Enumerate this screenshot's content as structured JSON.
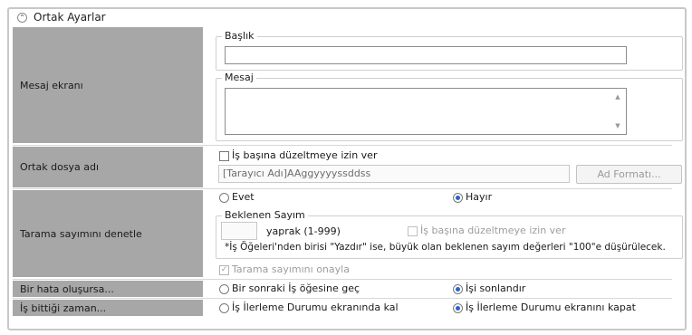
{
  "section": {
    "title": "Ortak Ayarlar"
  },
  "rows": {
    "message": {
      "label": "Mesaj ekranı",
      "title_group": "Başlık",
      "title_value": "",
      "message_group": "Mesaj",
      "message_value": ""
    },
    "filename": {
      "label": "Ortak dosya adı",
      "allow_edit": "İş başına düzeltmeye izin ver",
      "value": "[Tarayıcı Adı]AAggyyyyssddss",
      "format_button": "Ad Formatı..."
    },
    "scan_count": {
      "label": "Tarama sayımını denetle",
      "yes": "Evet",
      "no": "Hayır",
      "expected_group": "Beklenen Sayım",
      "pages_value": "",
      "pages_label": "yaprak (1-999)",
      "allow_edit": "İş başına düzeltmeye izin ver",
      "note": "*İş Öğeleri'nden birisi \"Yazdır\" ise, büyük olan beklenen sayım değerleri \"100\"e düşürülecek.",
      "confirm": "Tarama sayımını onayla"
    },
    "on_error": {
      "label": "Bir hata oluşursa...",
      "option_next": "Bir sonraki İş öğesine geç",
      "option_stop": "İşi sonlandır"
    },
    "on_finish": {
      "label": "İş bittiği zaman...",
      "option_stay": "İş İlerleme Durumu ekranında kal",
      "option_close": "İş İlerleme Durumu ekranını kapat"
    }
  }
}
